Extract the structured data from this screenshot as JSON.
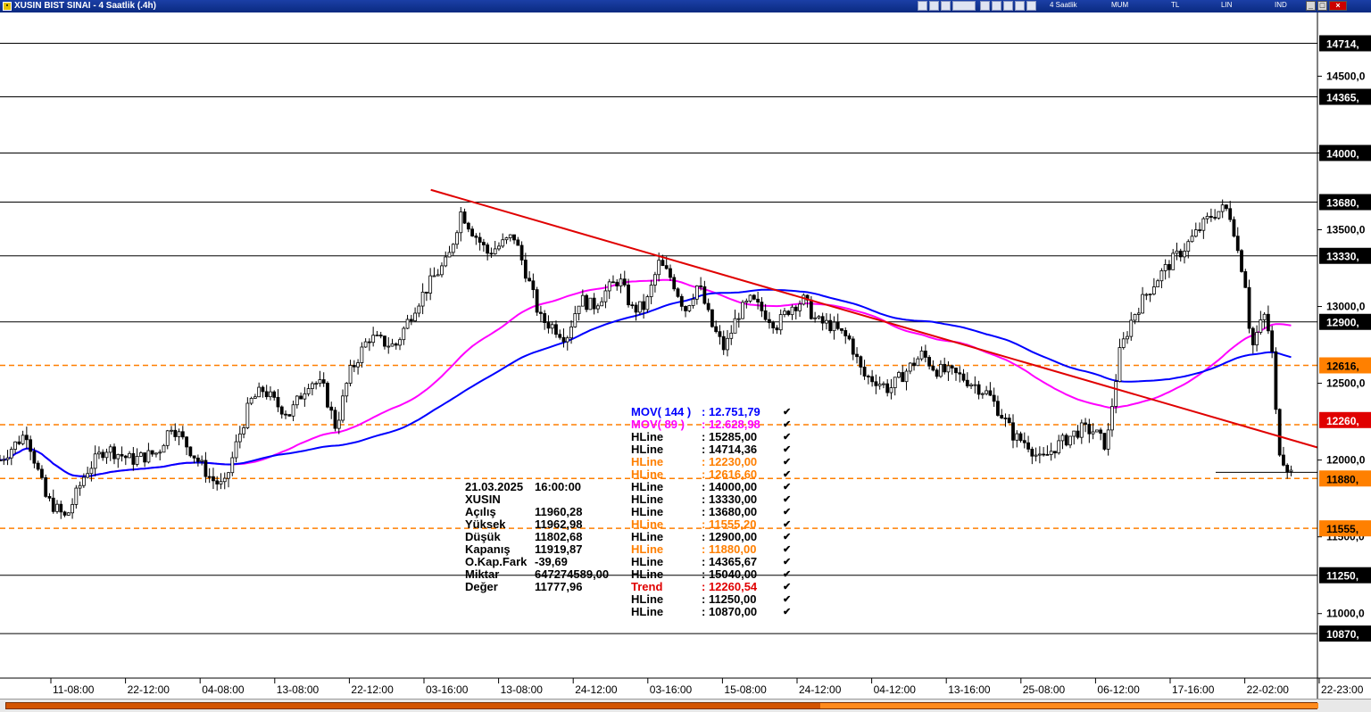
{
  "window": {
    "title": "XUSIN BIST SINAI - 4 Saatlik (.4h)",
    "period_label": "4 Saatlik",
    "menu": [
      "MUM",
      "TL",
      "LIN",
      "IND"
    ]
  },
  "price_axis": {
    "range": [
      10580,
      14880
    ],
    "major_labels": [
      "14500,0",
      "14000,",
      "13500,0",
      "13000,0",
      "12500,0",
      "12000,0",
      "11500,0",
      "11000,0"
    ],
    "major_values": [
      14500,
      14000,
      13500,
      13000,
      12500,
      12000,
      11500,
      11000
    ],
    "badges": [
      {
        "label": "14714,",
        "value": 14714.36,
        "style": "dark"
      },
      {
        "label": "14365,",
        "value": 14365.67,
        "style": "dark"
      },
      {
        "label": "14000,",
        "value": 14000,
        "style": "dark"
      },
      {
        "label": "13680,",
        "value": 13680,
        "style": "dark"
      },
      {
        "label": "13330,",
        "value": 13330,
        "style": "dark"
      },
      {
        "label": "12900,",
        "value": 12900,
        "style": "dark"
      },
      {
        "label": "12616,",
        "value": 12616.6,
        "style": "orange"
      },
      {
        "label": "12260,",
        "value": 12260.54,
        "style": "red"
      },
      {
        "label": "11880,",
        "value": 11880,
        "style": "orange"
      },
      {
        "label": "11555,",
        "value": 11555.2,
        "style": "orange"
      },
      {
        "label": "11250,",
        "value": 11250,
        "style": "dark"
      },
      {
        "label": "10870,",
        "value": 10870,
        "style": "dark"
      }
    ],
    "last_price_label": "11919,87"
  },
  "time_axis": {
    "labels": [
      "11-08:00",
      "22-12:00",
      "04-08:00",
      "13-08:00",
      "22-12:00",
      "03-16:00",
      "13-08:00",
      "24-12:00",
      "03-16:00",
      "15-08:00",
      "24-12:00",
      "04-12:00",
      "13-16:00",
      "25-08:00",
      "06-12:00",
      "17-16:00",
      "22-02:00",
      "22-23:00"
    ]
  },
  "chart_data": {
    "type": "candlestick",
    "symbol": "XUSIN",
    "hlines": [
      {
        "value": 14714.36,
        "color": "#000000",
        "style": "solid"
      },
      {
        "value": 14365.67,
        "color": "#000000",
        "style": "solid"
      },
      {
        "value": 14000.0,
        "color": "#000000",
        "style": "solid"
      },
      {
        "value": 13680.0,
        "color": "#000000",
        "style": "solid"
      },
      {
        "value": 13330.0,
        "color": "#000000",
        "style": "solid"
      },
      {
        "value": 12900.0,
        "color": "#000000",
        "style": "solid"
      },
      {
        "value": 12616.6,
        "color": "#ff7f00",
        "style": "dashed"
      },
      {
        "value": 12230.0,
        "color": "#ff7f00",
        "style": "dashed"
      },
      {
        "value": 11880.0,
        "color": "#ff7f00",
        "style": "dashed"
      },
      {
        "value": 11555.2,
        "color": "#ff7f00",
        "style": "dashed"
      },
      {
        "value": 11250.0,
        "color": "#000000",
        "style": "solid"
      },
      {
        "value": 10870.0,
        "color": "#000000",
        "style": "solid"
      }
    ],
    "trendline": {
      "from": {
        "bar": 0.327,
        "price": 13760
      },
      "to": {
        "bar": 1.0,
        "price": 12082
      },
      "color": "#e00000"
    },
    "ma144_last": 12751.79,
    "ma89_last": 12628.98,
    "price_path": [
      [
        0.0,
        12000
      ],
      [
        0.02,
        12180
      ],
      [
        0.035,
        11750
      ],
      [
        0.05,
        11620
      ],
      [
        0.065,
        11920
      ],
      [
        0.08,
        12080
      ],
      [
        0.1,
        12000
      ],
      [
        0.12,
        12050
      ],
      [
        0.13,
        12230
      ],
      [
        0.145,
        12060
      ],
      [
        0.16,
        11880
      ],
      [
        0.17,
        11820
      ],
      [
        0.18,
        12120
      ],
      [
        0.19,
        12380
      ],
      [
        0.2,
        12460
      ],
      [
        0.21,
        12360
      ],
      [
        0.22,
        12300
      ],
      [
        0.235,
        12520
      ],
      [
        0.245,
        12480
      ],
      [
        0.255,
        12210
      ],
      [
        0.265,
        12560
      ],
      [
        0.28,
        12800
      ],
      [
        0.3,
        12740
      ],
      [
        0.315,
        13000
      ],
      [
        0.33,
        13200
      ],
      [
        0.34,
        13300
      ],
      [
        0.35,
        13620
      ],
      [
        0.358,
        13500
      ],
      [
        0.37,
        13350
      ],
      [
        0.38,
        13400
      ],
      [
        0.39,
        13460
      ],
      [
        0.4,
        13200
      ],
      [
        0.41,
        12920
      ],
      [
        0.42,
        12870
      ],
      [
        0.43,
        12800
      ],
      [
        0.44,
        13050
      ],
      [
        0.45,
        13000
      ],
      [
        0.46,
        13100
      ],
      [
        0.47,
        13180
      ],
      [
        0.48,
        12980
      ],
      [
        0.49,
        13000
      ],
      [
        0.5,
        13280
      ],
      [
        0.51,
        13180
      ],
      [
        0.52,
        12980
      ],
      [
        0.53,
        13150
      ],
      [
        0.54,
        12880
      ],
      [
        0.55,
        12720
      ],
      [
        0.56,
        12950
      ],
      [
        0.57,
        13040
      ],
      [
        0.58,
        12960
      ],
      [
        0.59,
        12880
      ],
      [
        0.6,
        13000
      ],
      [
        0.61,
        13040
      ],
      [
        0.62,
        12900
      ],
      [
        0.63,
        12880
      ],
      [
        0.645,
        12780
      ],
      [
        0.655,
        12550
      ],
      [
        0.665,
        12520
      ],
      [
        0.675,
        12460
      ],
      [
        0.69,
        12600
      ],
      [
        0.7,
        12690
      ],
      [
        0.71,
        12590
      ],
      [
        0.72,
        12570
      ],
      [
        0.73,
        12540
      ],
      [
        0.74,
        12490
      ],
      [
        0.75,
        12430
      ],
      [
        0.76,
        12300
      ],
      [
        0.77,
        12150
      ],
      [
        0.78,
        12110
      ],
      [
        0.79,
        11990
      ],
      [
        0.8,
        12080
      ],
      [
        0.81,
        12140
      ],
      [
        0.82,
        12200
      ],
      [
        0.83,
        12190
      ],
      [
        0.84,
        12090
      ],
      [
        0.845,
        12420
      ],
      [
        0.85,
        12700
      ],
      [
        0.86,
        12940
      ],
      [
        0.87,
        13080
      ],
      [
        0.88,
        13200
      ],
      [
        0.89,
        13300
      ],
      [
        0.9,
        13390
      ],
      [
        0.91,
        13500
      ],
      [
        0.92,
        13600
      ],
      [
        0.93,
        13640
      ],
      [
        0.935,
        13580
      ],
      [
        0.94,
        13340
      ],
      [
        0.945,
        13180
      ],
      [
        0.95,
        12720
      ],
      [
        0.955,
        12850
      ],
      [
        0.96,
        12940
      ],
      [
        0.965,
        12760
      ],
      [
        0.97,
        12100
      ],
      [
        0.975,
        11990
      ],
      [
        0.98,
        11919
      ]
    ]
  },
  "ohlc": {
    "date": "21.03.2025",
    "time": "16:00:00",
    "symbol": "XUSIN",
    "rows": [
      {
        "label": "Açılış",
        "value": "11960,28"
      },
      {
        "label": "Yüksek",
        "value": "11962,98"
      },
      {
        "label": "Düşük",
        "value": "11802,68"
      },
      {
        "label": "Kapanış",
        "value": "11919,87"
      },
      {
        "label": "O.Kap.Fark",
        "value": "-39,69"
      },
      {
        "label": "Miktar",
        "value": "647274589,00"
      },
      {
        "label": "Değer",
        "value": "11777,96"
      }
    ]
  },
  "legend": [
    {
      "name": "MOV( 144 )",
      "value": ": 12.751,79",
      "color": "#0000ff"
    },
    {
      "name": "MOV( 89 )",
      "value": ": 12.628,98",
      "color": "#ff00ff"
    },
    {
      "name": "HLine",
      "value": ": 15285,00",
      "color": "#000000"
    },
    {
      "name": "HLine",
      "value": ": 14714,36",
      "color": "#000000"
    },
    {
      "name": "HLine",
      "value": ": 12230,00",
      "color": "#ff7f00"
    },
    {
      "name": "HLine",
      "value": ": 12616,60",
      "color": "#ff7f00"
    },
    {
      "name": "HLine",
      "value": ": 14000,00",
      "color": "#000000"
    },
    {
      "name": "HLine",
      "value": ": 13330,00",
      "color": "#000000"
    },
    {
      "name": "HLine",
      "value": ": 13680,00",
      "color": "#000000"
    },
    {
      "name": "HLine",
      "value": ": 11555,20",
      "color": "#ff7f00"
    },
    {
      "name": "HLine",
      "value": ": 12900,00",
      "color": "#000000"
    },
    {
      "name": "HLine",
      "value": ": 11880,00",
      "color": "#ff7f00"
    },
    {
      "name": "HLine",
      "value": ": 14365,67",
      "color": "#000000"
    },
    {
      "name": "HLine",
      "value": ": 15040,00",
      "color": "#000000"
    },
    {
      "name": "Trend",
      "value": ": 12260,54",
      "color": "#e00000"
    },
    {
      "name": "HLine",
      "value": ": 11250,00",
      "color": "#000000"
    },
    {
      "name": "HLine",
      "value": ": 10870,00",
      "color": "#000000"
    }
  ],
  "checkmark": "✔"
}
